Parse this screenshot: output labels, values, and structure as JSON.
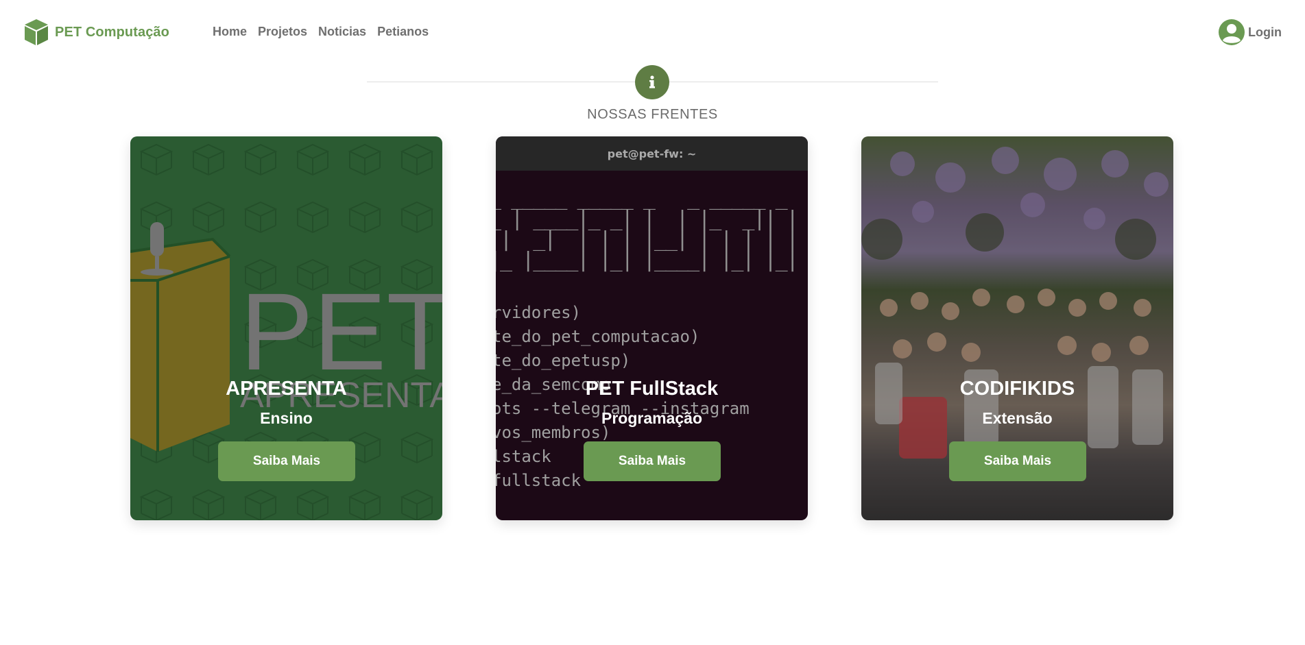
{
  "navbar": {
    "brand": "PET Computação",
    "links": [
      "Home",
      "Projetos",
      "Noticias",
      "Petianos"
    ],
    "login": "Login"
  },
  "section": {
    "title": "NOSSAS FRENTES"
  },
  "cards": [
    {
      "title": "APRESENTA",
      "subtitle": "Ensino",
      "button": "Saiba Mais",
      "logo_text": "PET",
      "logo_subtext": "APRESENTA"
    },
    {
      "title": "PET FullStack",
      "subtitle": "Programação",
      "button": "Saiba Mais",
      "terminal_title": "pet@pet-fw: ~",
      "terminal_lines": [
        "rvidores)",
        "te_do_pet_computacao)",
        "te_do_epetusp)",
        "e_da_semcomp",
        "ots --telegram --instagram",
        "vos_membros)",
        "lstack",
        "fullstack"
      ]
    },
    {
      "title": "CODIFIKIDS",
      "subtitle": "Extensão",
      "button": "Saiba Mais"
    }
  ],
  "colors": {
    "brand_green": "#6a9a52",
    "badge_green": "#5f7d44",
    "card1_bg": "#3a7a43",
    "card2_bg": "#220b1b"
  }
}
